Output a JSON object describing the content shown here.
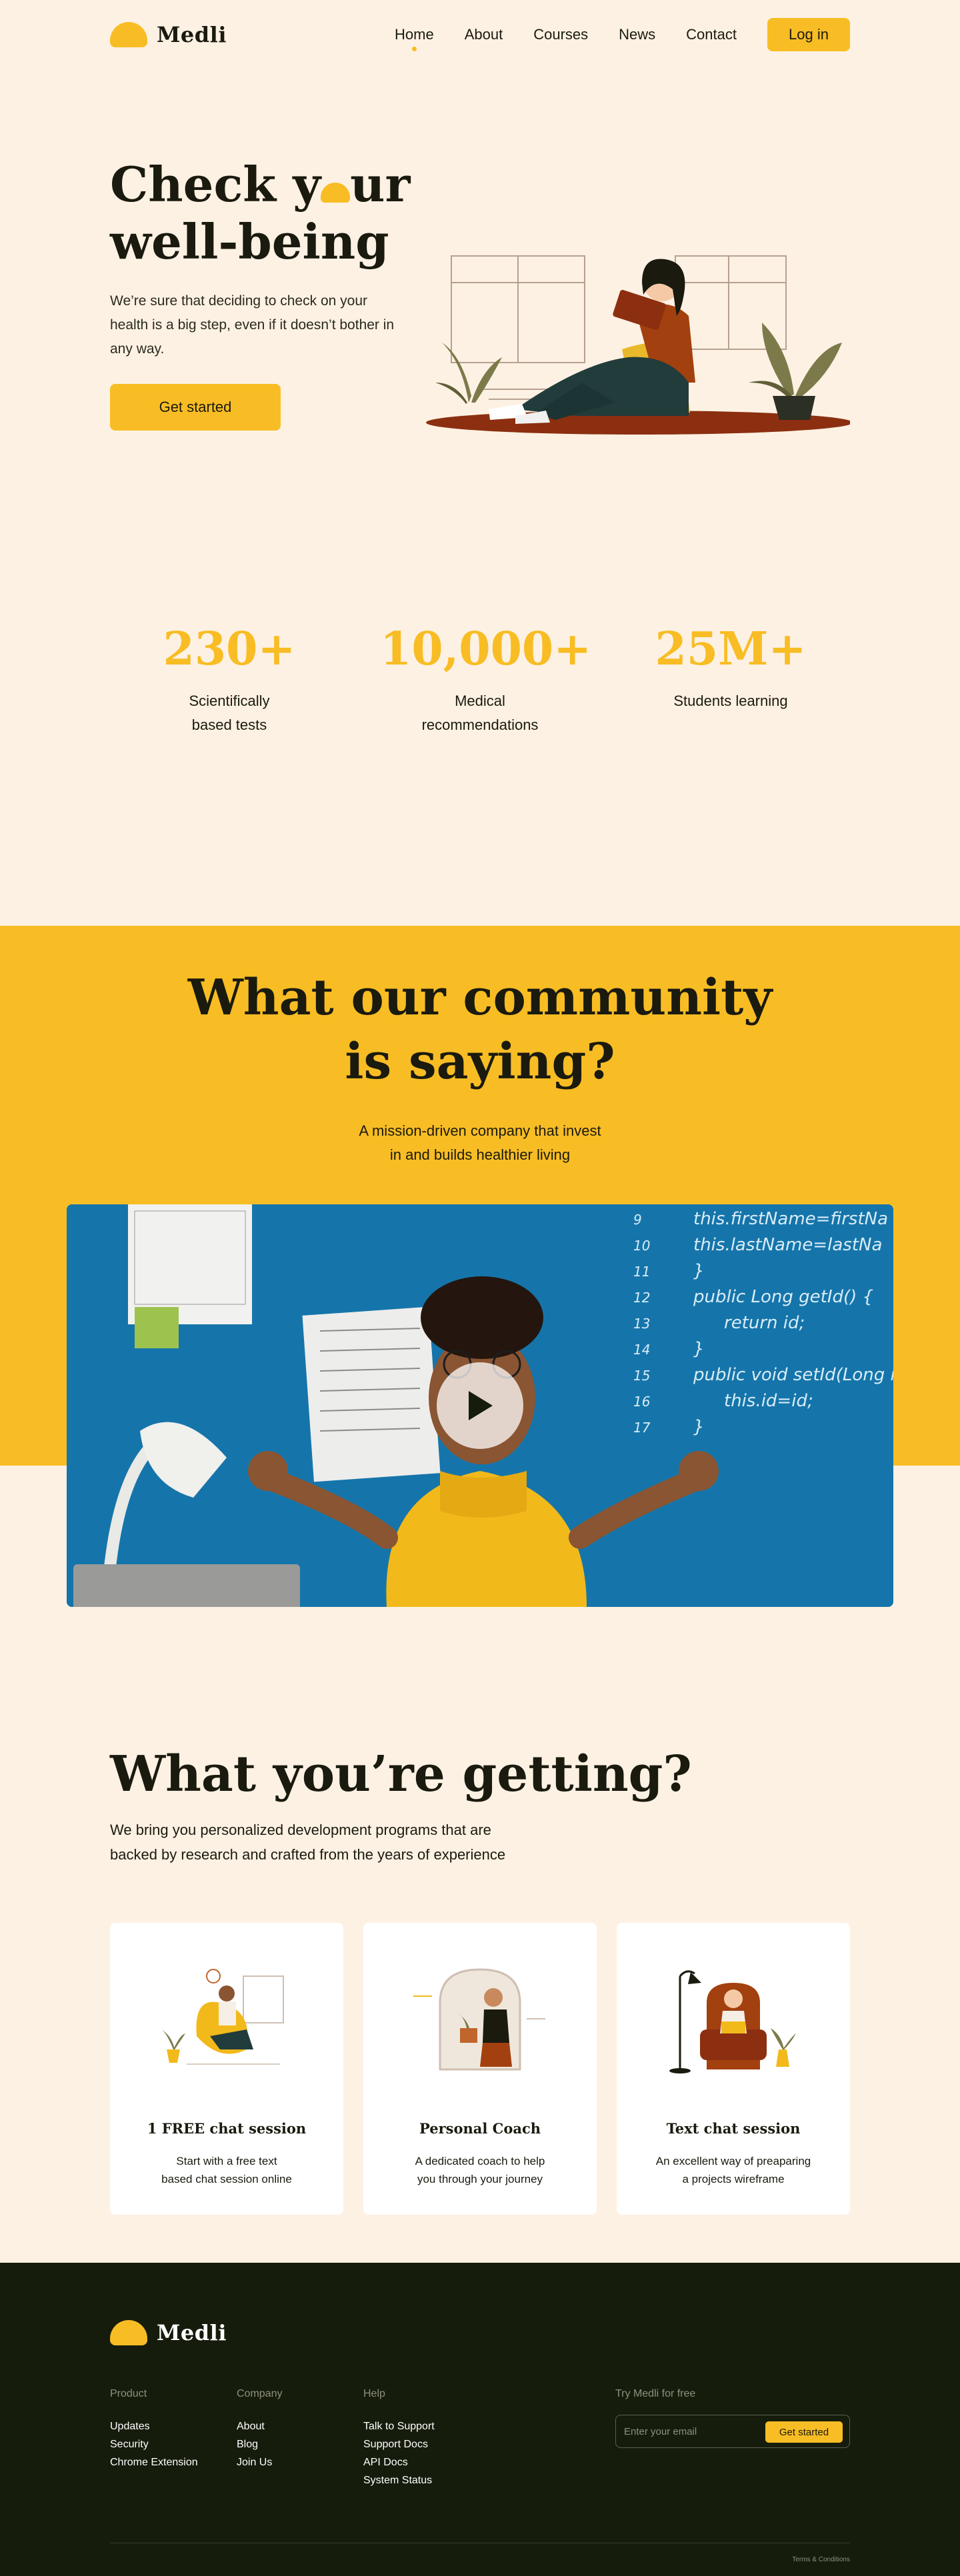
{
  "brand": {
    "name": "Medli",
    "accent": "#f8bd24",
    "background": "#fdf1e3",
    "dark": "#151c0c"
  },
  "nav": {
    "items": [
      "Home",
      "About",
      "Courses",
      "News",
      "Contact"
    ],
    "active": "Home",
    "login_label": "Log in"
  },
  "hero": {
    "title_part1": "Check y",
    "title_part2": "ur",
    "title_line2": "well-being",
    "text": "We’re sure that deciding to check on your health is a big step, even if it doesn’t bother in any way.",
    "cta_label": "Get started"
  },
  "stats": [
    {
      "number": "230+",
      "label_line1": "Scientifically",
      "label_line2": "based tests"
    },
    {
      "number": "10,000+",
      "label_line1": "Medical",
      "label_line2": "recommendations"
    },
    {
      "number": "25M+",
      "label_line1": "Students learning",
      "label_line2": ""
    }
  ],
  "community": {
    "title_line1": "What our community",
    "title_line2": "is saying?",
    "subtitle_line1": "A mission-driven company that invest",
    "subtitle_line2": "in and builds healthier living",
    "video_code": [
      "this.firstName=firstNa",
      "this.lastName=lastNa",
      "}",
      "public Long getId() {",
      "return id;",
      "}",
      "public void setId(Long i",
      "this.id=id;",
      "}"
    ],
    "video_line_numbers": [
      "9",
      "10",
      "11",
      "12",
      "13",
      "14",
      "15",
      "16",
      "17"
    ]
  },
  "getting": {
    "title": "What you’re getting?",
    "text_line1": "We bring you personalized development programs that are",
    "text_line2": "backed by research and crafted from the years of experience",
    "cards": [
      {
        "title": "1 FREE chat session",
        "text_line1": "Start with a free text",
        "text_line2": "based chat session online"
      },
      {
        "title": "Personal Coach",
        "text_line1": "A dedicated coach to help",
        "text_line2": "you through your journey"
      },
      {
        "title": "Text chat session",
        "text_line1": "An excellent way of preaparing",
        "text_line2": "a projects wireframe"
      }
    ]
  },
  "footer": {
    "columns": [
      {
        "heading": "Product",
        "links": [
          "Updates",
          "Security",
          "Chrome Extension"
        ]
      },
      {
        "heading": "Company",
        "links": [
          "About",
          "Blog",
          "Join Us"
        ]
      },
      {
        "heading": "Help",
        "links": [
          "Talk to Support",
          "Support Docs",
          "API Docs",
          "System Status"
        ]
      }
    ],
    "try_heading": "Try Medli for free",
    "email_placeholder": "Enter your email",
    "cta_label": "Get started",
    "terms": "Terms & Conditions"
  },
  "icons": {
    "play": "play-icon",
    "logo": "medli-logo-icon"
  }
}
